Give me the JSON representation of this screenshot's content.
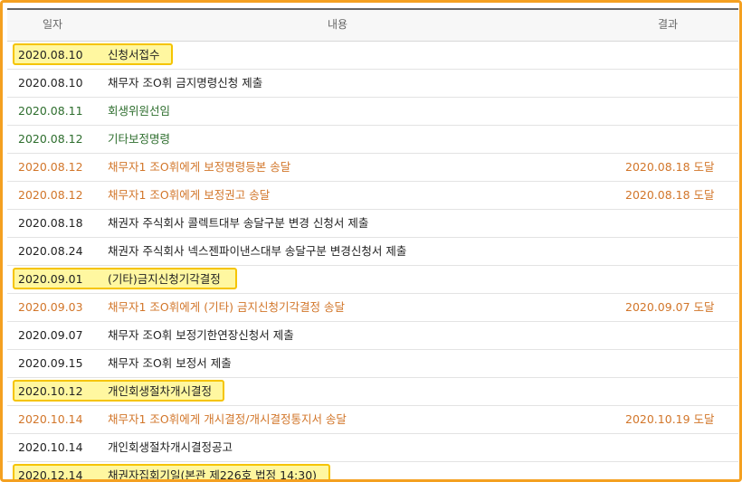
{
  "header": {
    "date": "일자",
    "content": "내용",
    "result": "결과"
  },
  "rows": [
    {
      "date": "2020.08.10",
      "content": "신청서접수",
      "result": "",
      "style": "normal",
      "highlight": true,
      "hl_w": 177
    },
    {
      "date": "2020.08.10",
      "content": "채무자 조O휘 금지명령신청 제출",
      "result": "",
      "style": "normal",
      "highlight": false
    },
    {
      "date": "2020.08.11",
      "content": "회생위원선임",
      "result": "",
      "style": "green",
      "highlight": false
    },
    {
      "date": "2020.08.12",
      "content": "기타보정명령",
      "result": "",
      "style": "green",
      "highlight": false
    },
    {
      "date": "2020.08.12",
      "content": "채무자1 조O휘에게 보정명령등본 송달",
      "result": "2020.08.18 도달",
      "style": "orange",
      "highlight": false
    },
    {
      "date": "2020.08.12",
      "content": "채무자1 조O휘에게 보정권고 송달",
      "result": "2020.08.18 도달",
      "style": "orange",
      "highlight": false
    },
    {
      "date": "2020.08.18",
      "content": "채권자 주식회사 콜렉트대부 송달구분 변경 신청서 제출",
      "result": "",
      "style": "normal",
      "highlight": false
    },
    {
      "date": "2020.08.24",
      "content": "채권자 주식회사 넥스젠파이낸스대부 송달구분 변경신청서 제출",
      "result": "",
      "style": "normal",
      "highlight": false
    },
    {
      "date": "2020.09.01",
      "content": "(기타)금지신청기각결정",
      "result": "",
      "style": "normal",
      "highlight": true,
      "hl_w": 248
    },
    {
      "date": "2020.09.03",
      "content": "채무자1 조O휘에게 (기타) 금지신청기각결정 송달",
      "result": "2020.09.07 도달",
      "style": "orange",
      "highlight": false
    },
    {
      "date": "2020.09.07",
      "content": "채무자 조O휘 보정기한연장신청서 제출",
      "result": "",
      "style": "normal",
      "highlight": false
    },
    {
      "date": "2020.09.15",
      "content": "채무자 조O휘 보정서 제출",
      "result": "",
      "style": "normal",
      "highlight": false
    },
    {
      "date": "2020.10.12",
      "content": "개인회생절차개시결정",
      "result": "",
      "style": "normal",
      "highlight": true,
      "hl_w": 234
    },
    {
      "date": "2020.10.14",
      "content": "채무자1 조O휘에게 개시결정/개시결정통지서 송달",
      "result": "2020.10.19 도달",
      "style": "orange",
      "highlight": false
    },
    {
      "date": "2020.10.14",
      "content": "개인회생절차개시결정공고",
      "result": "",
      "style": "normal",
      "highlight": false
    },
    {
      "date": "2020.12.14",
      "content": "채권자집회기일(본관 제226호 법정 14:30)",
      "result": "",
      "style": "normal",
      "highlight": true,
      "hl_w": 351
    }
  ]
}
